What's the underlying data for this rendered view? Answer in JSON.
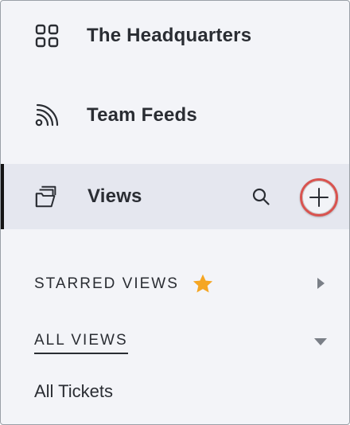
{
  "nav": {
    "items": [
      {
        "label": "The Headquarters",
        "icon": "grid-icon"
      },
      {
        "label": "Team Feeds",
        "icon": "rss-feed-icon"
      },
      {
        "label": "Views",
        "icon": "folders-icon",
        "active": true
      }
    ]
  },
  "views_actions": {
    "search_icon": "search-icon",
    "add_icon": "plus-icon",
    "add_highlight_color": "#d9534f"
  },
  "sections": {
    "starred": {
      "label": "STARRED VIEWS",
      "icon": "star-icon",
      "star_color": "#f5a623",
      "expanded": false
    },
    "all": {
      "label": "ALL VIEWS",
      "expanded": true,
      "items": [
        "All Tickets"
      ]
    }
  },
  "colors": {
    "background": "#f3f4f8",
    "active_background": "#e5e7ef",
    "active_indicator": "#141414",
    "text": "#2a2d33"
  }
}
